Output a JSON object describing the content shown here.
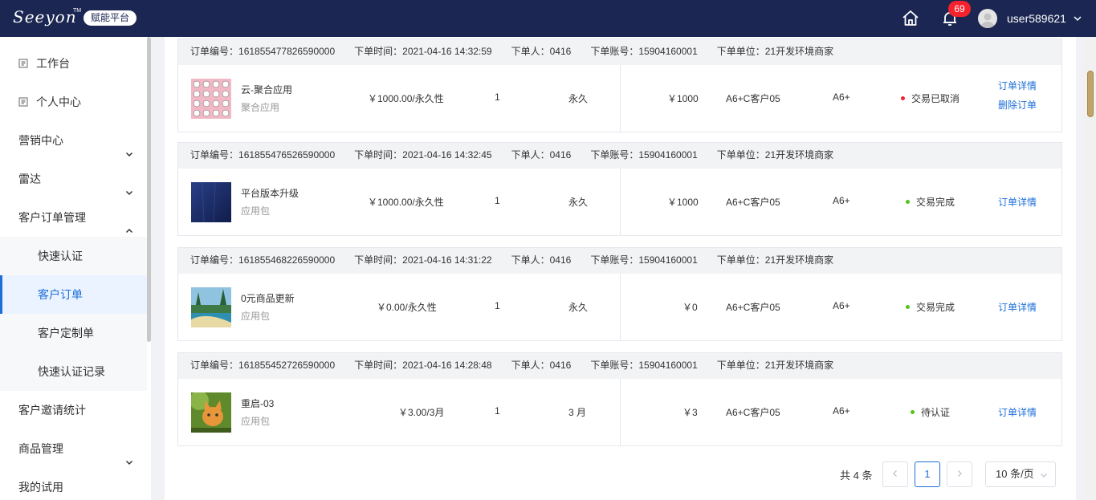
{
  "header": {
    "logo_text": "Seeyon",
    "logo_tm": "TM",
    "logo_badge": "赋能平台",
    "notification_count": "69",
    "username": "user589621"
  },
  "sidebar": {
    "items": [
      {
        "label": "工作台"
      },
      {
        "label": "个人中心"
      },
      {
        "label": "营销中心"
      },
      {
        "label": "雷达"
      },
      {
        "label": "客户订单管理"
      },
      {
        "label": "快速认证"
      },
      {
        "label": "客户订单"
      },
      {
        "label": "客户定制单"
      },
      {
        "label": "快速认证记录"
      },
      {
        "label": "客户邀请统计"
      },
      {
        "label": "商品管理"
      },
      {
        "label": "我的试用"
      }
    ]
  },
  "labels": {
    "order_no": "订单编号：",
    "order_time": "下单时间：",
    "orderer": "下单人：",
    "account": "下单账号：",
    "unit": "下单单位："
  },
  "orders": [
    {
      "order_no": "161855477826590000",
      "order_time": "2021-04-16 14:32:59",
      "orderer": "0416",
      "account": "15904160001",
      "unit": "21开发环境商家",
      "product_name": "云-聚合应用",
      "product_type": "聚合应用",
      "price": "￥1000.00/永久性",
      "quantity": "1",
      "duration": "永久",
      "amount": "￥1000",
      "customer": "A6+C客户05",
      "edition": "A6+",
      "status": "交易已取消",
      "status_color": "#f5222d",
      "links": [
        "订单详情",
        "删除订单"
      ]
    },
    {
      "order_no": "161855476526590000",
      "order_time": "2021-04-16 14:32:45",
      "orderer": "0416",
      "account": "15904160001",
      "unit": "21开发环境商家",
      "product_name": "平台版本升级",
      "product_type": "应用包",
      "price": "￥1000.00/永久性",
      "quantity": "1",
      "duration": "永久",
      "amount": "￥1000",
      "customer": "A6+C客户05",
      "edition": "A6+",
      "status": "交易完成",
      "status_color": "#52c41a",
      "links": [
        "订单详情"
      ]
    },
    {
      "order_no": "161855468226590000",
      "order_time": "2021-04-16 14:31:22",
      "orderer": "0416",
      "account": "15904160001",
      "unit": "21开发环境商家",
      "product_name": "0元商品更新",
      "product_type": "应用包",
      "price": "￥0.00/永久性",
      "quantity": "1",
      "duration": "永久",
      "amount": "￥0",
      "customer": "A6+C客户05",
      "edition": "A6+",
      "status": "交易完成",
      "status_color": "#52c41a",
      "links": [
        "订单详情"
      ]
    },
    {
      "order_no": "161855452726590000",
      "order_time": "2021-04-16 14:28:48",
      "orderer": "0416",
      "account": "15904160001",
      "unit": "21开发环境商家",
      "product_name": "重启-03",
      "product_type": "应用包",
      "price": "￥3.00/3月",
      "quantity": "1",
      "duration": "3 月",
      "amount": "￥3",
      "customer": "A6+C客户05",
      "edition": "A6+",
      "status": "待认证",
      "status_color": "#52c41a",
      "links": [
        "订单详情"
      ]
    }
  ],
  "pagination": {
    "total": "共 4 条",
    "current_page": "1",
    "page_size": "10 条/页"
  },
  "colors": {
    "header_bg": "#1b2752",
    "accent": "#1d6fd8"
  }
}
